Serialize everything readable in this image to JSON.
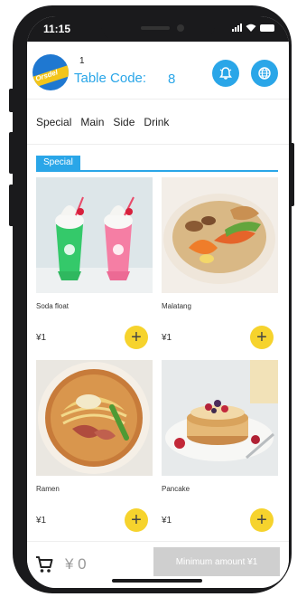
{
  "status_bar": {
    "time": "11:15"
  },
  "header": {
    "logo_text": "Orsdel",
    "seat_number": "1",
    "table_label": "Table Code:",
    "table_code": "8",
    "icons": [
      "bell-icon",
      "globe-icon"
    ],
    "accent_color": "#2aa6e8"
  },
  "tabs": [
    {
      "label": "Special"
    },
    {
      "label": "Main"
    },
    {
      "label": "Side"
    },
    {
      "label": "Drink"
    }
  ],
  "section": {
    "label": "Special"
  },
  "products": [
    {
      "name": "Soda float",
      "price": "¥1",
      "add_label": "+"
    },
    {
      "name": "Malatang",
      "price": "¥1",
      "add_label": "+"
    },
    {
      "name": "Ramen",
      "price": "¥1",
      "add_label": "+"
    },
    {
      "name": "Pancake",
      "price": "¥1",
      "add_label": "+"
    }
  ],
  "bottom_bar": {
    "cart_total": "¥ 0",
    "checkout_label": "Minimum amount ¥1"
  },
  "colors": {
    "add_button": "#f6d32d",
    "checkout_disabled": "#cfcfcf"
  }
}
